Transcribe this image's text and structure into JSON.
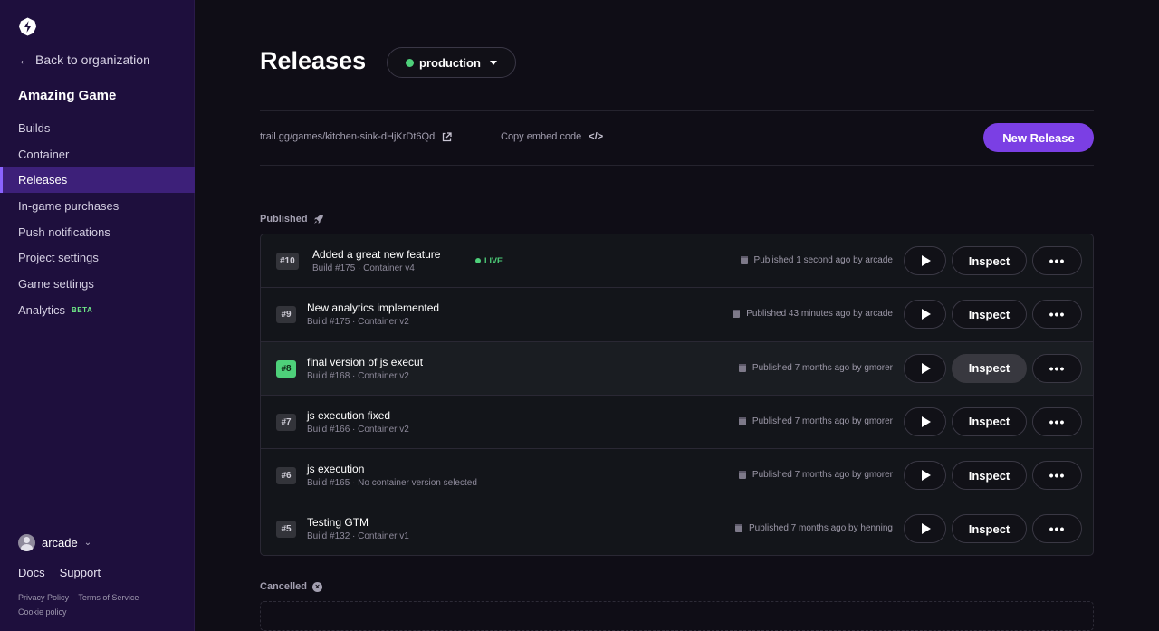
{
  "sidebar": {
    "back_label": "Back to organization",
    "project_title": "Amazing Game",
    "items": [
      {
        "label": "Builds"
      },
      {
        "label": "Container"
      },
      {
        "label": "Releases"
      },
      {
        "label": "In-game purchases"
      },
      {
        "label": "Push notifications"
      },
      {
        "label": "Project settings"
      },
      {
        "label": "Game settings"
      },
      {
        "label": "Analytics",
        "badge": "BETA"
      }
    ],
    "user_name": "arcade",
    "docs_label": "Docs",
    "support_label": "Support",
    "privacy_label": "Privacy Policy",
    "terms_label": "Terms of Service",
    "cookie_label": "Cookie policy"
  },
  "header": {
    "title": "Releases",
    "environment": "production",
    "env_color": "#4ed07a"
  },
  "toolbar": {
    "url": "trail.gg/games/kitchen-sink-dHjKrDt6Qd",
    "embed_label": "Copy embed code",
    "new_release_label": "New Release",
    "accent": "#7b3fe4"
  },
  "published_label": "Published",
  "live_label": "LIVE",
  "inspect_label": "Inspect",
  "releases": [
    {
      "num": "#10",
      "title": "Added a great new feature",
      "sub": "Build #175 · Container v4",
      "meta": "Published 1 second ago by arcade"
    },
    {
      "num": "#9",
      "title": "New analytics implemented",
      "sub": "Build #175 · Container v2",
      "meta": "Published 43 minutes ago by arcade"
    },
    {
      "num": "#8",
      "title": "final version of js execut",
      "sub": "Build #168 · Container v2",
      "meta": "Published 7 months ago by gmorer"
    },
    {
      "num": "#7",
      "title": "js execution fixed",
      "sub": "Build #166 · Container v2",
      "meta": "Published 7 months ago by gmorer"
    },
    {
      "num": "#6",
      "title": "js execution",
      "sub": "Build #165 · No container version selected",
      "meta": "Published 7 months ago by gmorer"
    },
    {
      "num": "#5",
      "title": "Testing GTM",
      "sub": "Build #132 · Container v1",
      "meta": "Published 7 months ago by henning"
    }
  ],
  "cancelled_label": "Cancelled"
}
